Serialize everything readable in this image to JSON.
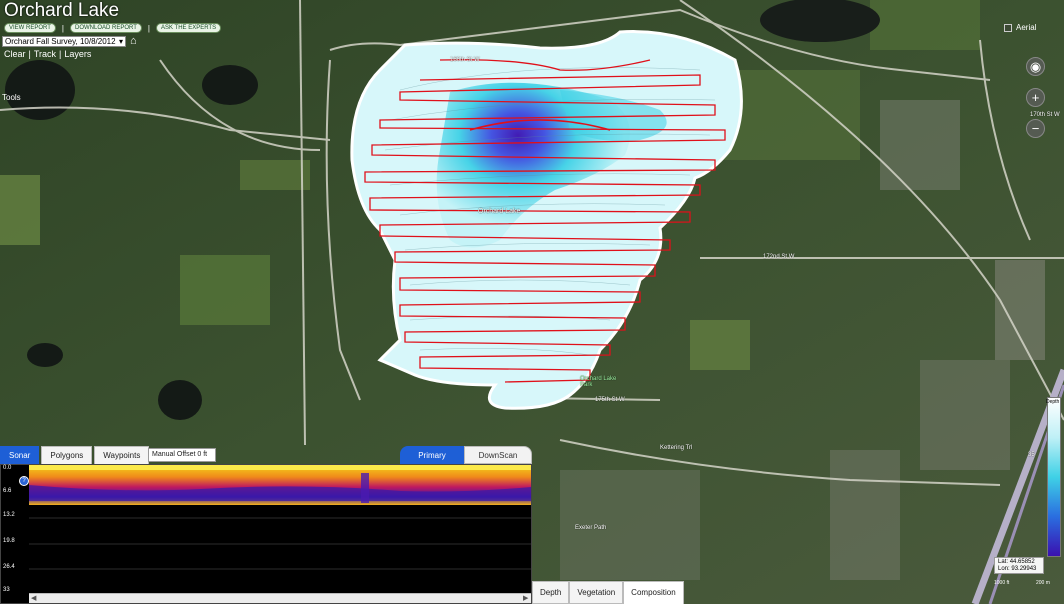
{
  "header": {
    "title": "Orchard Lake",
    "links": [
      "VIEW REPORT",
      "DOWNLOAD REPORT",
      "ASK THE EXPERTS"
    ],
    "link_separator": "|",
    "survey_select": "Orchard Fall Survey, 10/8/2012",
    "controls": [
      "Clear",
      "Track",
      "Layers"
    ],
    "control_separator": "|",
    "tools_label": "Tools"
  },
  "map": {
    "aerial_label": "Aerial",
    "lake_label": "Orchard Lake",
    "park_label": "Orchard Lake Park",
    "roads": [
      "160th St W",
      "170th St W",
      "172nd St W",
      "175th St W",
      "Kettering Trl",
      "Exeter Path",
      "35"
    ],
    "colors": {
      "track": "#e0101a",
      "lake_edge": "#ffffff",
      "shallow": "#c4f3f7",
      "mid": "#3fd1e6",
      "deep": "#3a10b0"
    },
    "legend_label": "Depth",
    "lat_label": "Lat:",
    "lat_value": "44.65852",
    "lon_label": "Lon:",
    "lon_value": "93.29943",
    "scale_left": "1000 ft",
    "scale_right": "200 m"
  },
  "sonar": {
    "tabs": [
      "Sonar",
      "Polygons",
      "Waypoints"
    ],
    "active_tab": "Sonar",
    "manual_offset": "Manual Offset 0 ft",
    "source_tabs": [
      "Primary",
      "DownScan"
    ],
    "active_source": "Primary",
    "depth_ticks": [
      "0.0",
      "6.6",
      "13.2",
      "19.8",
      "26.4",
      "33"
    ],
    "marker_label": "?",
    "scroll_left": "◀",
    "scroll_right": "▶"
  },
  "bottom_tabs": [
    "Depth",
    "Vegetation",
    "Composition"
  ],
  "active_bottom_tab": "Composition"
}
